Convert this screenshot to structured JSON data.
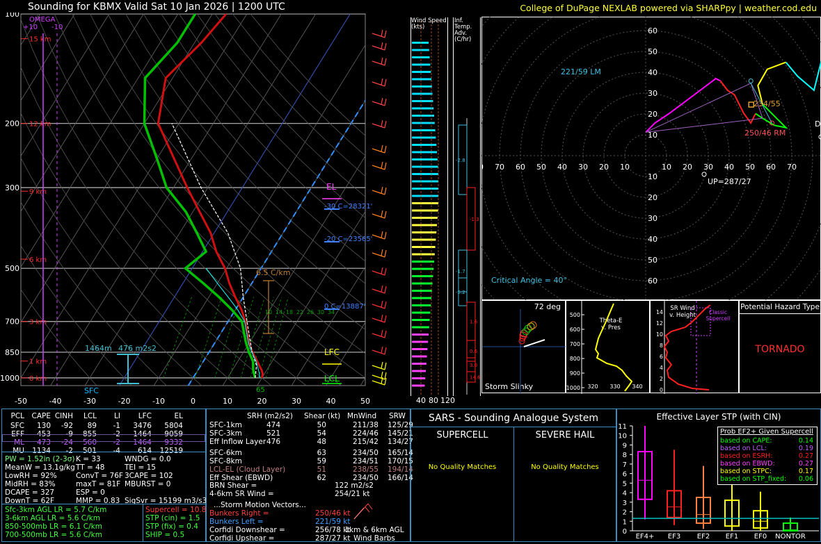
{
  "header": {
    "title": "Sounding for KBMX Valid  Sat 10 Jan 2026 | 1200 UTC",
    "credit": "College of DuPage NEXLAB powered via SHARPpy | weather.cod.edu"
  },
  "colors": {
    "temperature": "#d01010",
    "dewpoint": "#00c000",
    "wetbulb": "#00ffff",
    "parcel": "#f0f0f0",
    "panel_border": "#3a8fc0",
    "hodo_0_3": "#ff00ff",
    "hodo_3_6": "#ff2020",
    "hodo_6_9": "#00ff00",
    "hodo_9_12": "#ffff00",
    "hodo_12plus": "#00ffff"
  },
  "skewt": {
    "pressure_labels": [
      "100",
      "200",
      "300",
      "500",
      "700",
      "850",
      "1000"
    ],
    "temp_labels": [
      "-50",
      "-40",
      "-30",
      "-20",
      "-10",
      "0",
      "10",
      "20",
      "30",
      "40",
      "50"
    ],
    "height_labels": [
      "15 km",
      "12 km",
      "9 km",
      "6 km",
      "3 km",
      "1 km",
      "0 km"
    ],
    "omega_title": "OMEGA",
    "omega_scale": [
      "+10",
      "-10"
    ],
    "annotations": {
      "el": "EL",
      "lfc": "LFC",
      "lcl": "LCL",
      "lapse": "6.5 C/km",
      "m30": "-30 C=28321'",
      "m20": "-20 C=23565'",
      "zero": "0 C=13887'",
      "sfc": "SFC",
      "eff_height": "1464m",
      "eff_srh": "476 m2s2",
      "sfc_dewpt": "65"
    },
    "mixing_ratios": [
      "10",
      "14",
      "18",
      "22",
      "26",
      "30",
      "34"
    ],
    "inf_temp_header": "Inf. Temp. Adv.(C/hr)",
    "wind_speed_header": "Wind Speed (kts)",
    "wind_speed_scale": [
      "40",
      "80",
      "120"
    ],
    "inf_values": [
      "-2.8",
      "-1.3",
      "-1.7",
      "-5.2",
      "1.6",
      "0.6",
      "3.0",
      "14.6"
    ]
  },
  "chart_data": [
    {
      "type": "line",
      "title": "Sounding for KBMX Valid  Sat 10 Jan 2026 | 1200 UTC",
      "xlabel": "",
      "ylabel": "",
      "y_scale": "log (pressure, mb)",
      "ylim": [
        1050,
        100
      ],
      "xlim": [
        -50,
        50
      ],
      "series": [
        {
          "name": "",
          "pressure": [
            1000,
            975,
            950,
            925,
            900,
            850,
            800,
            700,
            650,
            600,
            550,
            500,
            450,
            400,
            350,
            300,
            250,
            200,
            150,
            120,
            100
          ],
          "values": [
            20,
            19.5,
            18.4,
            17,
            15.6,
            12.6,
            9.8,
            5,
            1.8,
            -2.3,
            -6.5,
            -10.5,
            -16,
            -21,
            -28,
            -36,
            -45,
            -56,
            -62,
            -58,
            -56
          ]
        },
        {
          "name": "",
          "pressure": [
            1000,
            975,
            950,
            925,
            900,
            850,
            800,
            700,
            650,
            600,
            550,
            500,
            450,
            400,
            350,
            300,
            250,
            200,
            150,
            120,
            100
          ],
          "values": [
            18,
            17,
            16,
            15.2,
            14.4,
            11.6,
            9,
            4,
            -1,
            -7,
            -14,
            -22,
            -19,
            -25,
            -32,
            -42,
            -50,
            -60,
            -68,
            -65,
            -65
          ]
        },
        {
          "name": "",
          "pressure": [
            1000,
            925,
            850,
            700,
            600,
            500,
            400,
            300,
            250,
            200
          ],
          "values": [
            18,
            16.2,
            12.5,
            5.5,
            0,
            -6,
            -16,
            -32,
            -41,
            -52
          ]
        }
      ]
    },
    {
      "type": "scatter",
      "title": "Hodograph",
      "xlabel": "kt",
      "ylabel": "kt",
      "xlim": [
        -80,
        80
      ],
      "ylim": [
        -80,
        70
      ],
      "storm_motions": {
        "left_mover": {
          "label": "221/59 LM",
          "dir": 221,
          "spd": 59
        },
        "right_mover": {
          "label": "250/46 RM",
          "dir": 250,
          "spd": 46
        },
        "mean_wind": {
          "label": "234/55",
          "dir": 234,
          "spd": 55
        },
        "upshear": {
          "label": "UP=287/27",
          "dir": 287,
          "spd": 27
        }
      },
      "critical_angle": "Critical Angle = 40°",
      "ring_labels": [
        "10",
        "20",
        "30",
        "40",
        "50",
        "60",
        "70"
      ],
      "hodograph_points_kt": [
        [
          0,
          10
        ],
        [
          4,
          14
        ],
        [
          10,
          18
        ],
        [
          18,
          24
        ],
        [
          26,
          30
        ],
        [
          30,
          33
        ],
        [
          32,
          32
        ],
        [
          35,
          28
        ],
        [
          38,
          26
        ],
        [
          42,
          18
        ],
        [
          45,
          14
        ],
        [
          47,
          18
        ],
        [
          50,
          16
        ],
        [
          55,
          13
        ],
        [
          60,
          12
        ],
        [
          50,
          22
        ],
        [
          48,
          30
        ],
        [
          52,
          37
        ],
        [
          60,
          40
        ],
        [
          65,
          34
        ],
        [
          72,
          28
        ],
        [
          75,
          40
        ],
        [
          80,
          32
        ]
      ]
    },
    {
      "type": "bar",
      "title": "Effective Layer STP (with CIN)",
      "categories": [
        "EF4+",
        "EF3",
        "EF2",
        "EF1",
        "EF0",
        "NONTOR"
      ],
      "box_whisker": [
        {
          "name": "EF4+",
          "min": 1.2,
          "q1": 3.3,
          "median": 5.3,
          "q3": 8.3,
          "max": 11
        },
        {
          "name": "EF3",
          "min": 0.6,
          "q1": 1.4,
          "median": 2.5,
          "q3": 4.2,
          "max": 8.5
        },
        {
          "name": "EF2",
          "min": 0.2,
          "q1": 0.8,
          "median": 1.7,
          "q3": 3.5,
          "max": 6.8
        },
        {
          "name": "EF1",
          "min": 0,
          "q1": 0.5,
          "median": 1.3,
          "q3": 3.2,
          "max": 5.4
        },
        {
          "name": "EF0",
          "min": 0,
          "q1": 0.3,
          "median": 1.0,
          "q3": 2.1,
          "max": 4.1
        },
        {
          "name": "NONTOR",
          "min": 0,
          "q1": 0,
          "median": 0.1,
          "q3": 0.8,
          "max": 1.4
        }
      ],
      "current_value": 1.3,
      "ylim": [
        0,
        11
      ],
      "yticks": [
        "0",
        "1",
        "2",
        "3",
        "4",
        "5",
        "6",
        "7",
        "8",
        "9",
        "10",
        "11"
      ]
    }
  ],
  "hodo_ring_labels": [
    "10",
    "20",
    "30",
    "40",
    "50",
    "60"
  ],
  "hodo_x_labels": [
    "80",
    "70",
    "60",
    "50",
    "40",
    "30",
    "20",
    "10",
    "10",
    "20",
    "30",
    "40",
    "50",
    "60",
    "70"
  ],
  "hodo_extra": {
    "d_label": "D"
  },
  "slinky": {
    "title": "72 deg",
    "footer": "Storm Slinky"
  },
  "thetae": {
    "title": "Theta-E v. Pres",
    "yticks": [
      "500",
      "600",
      "700",
      "800",
      "900",
      "1000"
    ],
    "xticks": [
      "320",
      "330",
      "340"
    ]
  },
  "srwind": {
    "title": "SR Wind v. Height",
    "yticks": [
      "14",
      "12",
      "10",
      "8",
      "6",
      "4",
      "2",
      "0"
    ],
    "classic": "Classic Supercell"
  },
  "hazard": {
    "title": "Potential Hazard Type",
    "value": "TORNADO"
  },
  "parcels": {
    "headers": [
      "PCL",
      "CAPE",
      "CINH",
      "LCL",
      "LI",
      "LFC",
      "EL"
    ],
    "rows": [
      [
        "SFC",
        "130",
        "-92",
        "89",
        "-1",
        "3476",
        "5804"
      ],
      [
        "EFF",
        "453",
        "-9",
        "855",
        "-2",
        "1464",
        "9059"
      ],
      [
        "ML",
        "473",
        "-24",
        "560",
        "-2",
        "1464",
        "9332"
      ],
      [
        "MU",
        "1134",
        "-2",
        "501",
        "-4",
        "614",
        "12519"
      ]
    ]
  },
  "thermo": {
    "col1": [
      "PW = 1.52in (2-3σ)",
      "MeanW = 13.1g/kg",
      "LowRH = 92%",
      "MidRH = 83%",
      "DCAPE = 327",
      "DownT = 62F"
    ],
    "col2": [
      "K = 33",
      "TT = 48",
      "ConvT = 76F",
      "maxT = 81F",
      "ESP = 0",
      "MMP = 0.83"
    ],
    "col3": [
      "WNDG = 0.0",
      "TEI = 15",
      "3CAPE = 102",
      "MBURST = 0",
      "",
      "SigSvr = 15199 m3/s3"
    ]
  },
  "lapse": [
    "Sfc-3km AGL LR = 5.7 C/km",
    "3-6km AGL LR = 5.6 C/km",
    "850-500mb LR = 6.1 C/km",
    "700-500mb LR = 5.6 C/km"
  ],
  "composites": [
    "Supercell = 10.8",
    "STP (cin) = 1.5",
    "STP (fix) = 0.4",
    "SHIP = 0.5"
  ],
  "kinematics": {
    "headers": [
      "SRH (m2/s2)",
      "Shear (kt)",
      "MnWind",
      "SRW"
    ],
    "rows": [
      [
        "SFC-1km",
        "474",
        "50",
        "211/38",
        "125/29"
      ],
      [
        "SFC-3km",
        "521",
        "54",
        "224/46",
        "145/21"
      ],
      [
        "Eff Inflow Layer",
        "476",
        "48",
        "215/42",
        "134/27"
      ],
      [
        "SFC-6km",
        "",
        "63",
        "234/50",
        "165/14"
      ],
      [
        "SFC-8km",
        "",
        "59",
        "234/51",
        "170/15"
      ],
      [
        "LCL-EL (Cloud Layer)",
        "",
        "51",
        "238/55",
        "194/14"
      ],
      [
        "Eff Shear (EBWD)",
        "",
        "62",
        "234/50",
        "166/14"
      ]
    ],
    "brn": "BRN Shear =",
    "brn_val": "122 m2/s2",
    "srwind": "4-6km SR Wind =",
    "srwind_val": "254/21 kt",
    "storm_header": "...Storm Motion Vectors...",
    "motions": [
      [
        "Bunkers Right =",
        "250/46 kt"
      ],
      [
        "Bunkers Left =",
        "221/59 kt"
      ],
      [
        "Corfidi Downshear =",
        "256/78 kt"
      ],
      [
        "Corfidi Upshear =",
        "287/27 kt"
      ]
    ],
    "barb_caption": "1km & 6km AGL Wind Barbs"
  },
  "sars": {
    "title": "SARS - Sounding Analogue System",
    "supercell": "SUPERCELL",
    "hail": "SEVERE HAIL",
    "supercell_msg": "No Quality Matches",
    "hail_msg": "No Quality Matches"
  },
  "stp": {
    "title": "Effective Layer STP (with CIN)",
    "prob_title": "Prob EF2+ Given Supercell",
    "probs": [
      [
        "based on CAPE:",
        "0.14"
      ],
      [
        "based on LCL:",
        "0.19"
      ],
      [
        "based on ESRH:",
        "0.27"
      ],
      [
        "based on EBWD:",
        "0.27"
      ],
      [
        "based on STPC:",
        "0.17"
      ],
      [
        "based on STP_fixed:",
        "0.06"
      ]
    ]
  }
}
